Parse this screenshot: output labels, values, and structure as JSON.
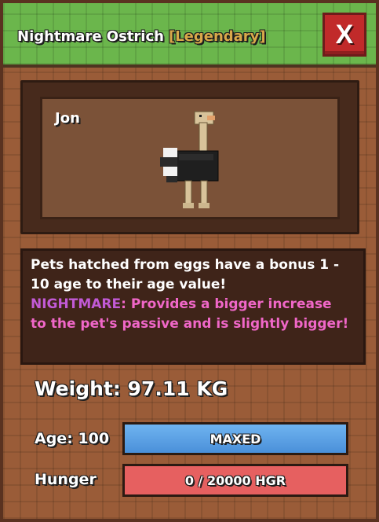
{
  "header": {
    "pet_title": "Nightmare Ostrich",
    "rarity": "[Legendary]",
    "close_label": "X"
  },
  "pet": {
    "name": "Jon"
  },
  "description": {
    "line1": "Pets hatched from eggs have a bonus 1 -",
    "line2": "10 age to their age value!",
    "line3_prefix": "NIGHTMARE",
    "line3_rest": ": Provides a bigger increase",
    "line4": "to the pet's passive and is slightly bigger!"
  },
  "stats": {
    "weight": "Weight: 97.11 KG",
    "age_label": "Age: 100",
    "age_bar_text": "MAXED",
    "age_progress": 1.0,
    "hunger_label": "Hunger",
    "hunger_bar_text": "0 / 20000 HGR",
    "hunger_progress": 0
  },
  "colors": {
    "rarity": "#d9a94a",
    "nightmare": "#c25ad6",
    "description_pink": "#f067c8",
    "age_bar": "#4a90d9",
    "hunger_bar": "#e66060",
    "close_button": "#c12a2a"
  },
  "icons": {
    "close": "close-icon",
    "pet_model": "ostrich-model-icon"
  }
}
